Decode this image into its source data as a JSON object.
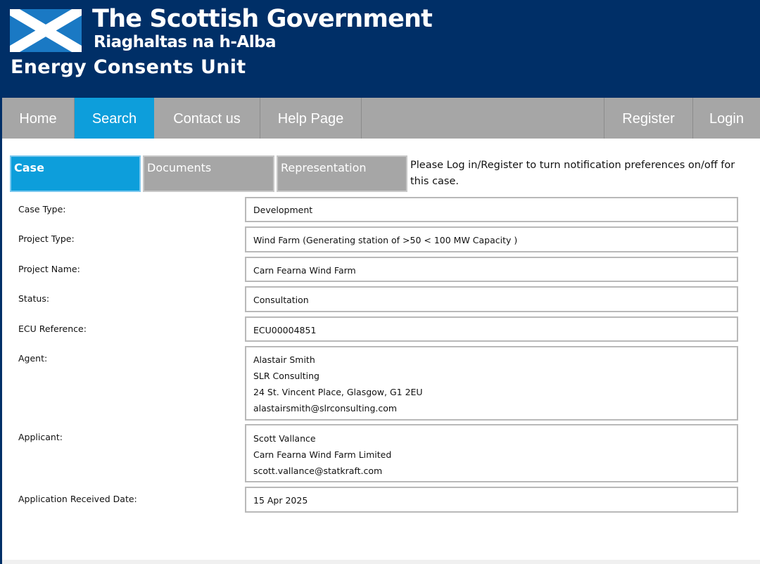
{
  "header": {
    "gov_title": "The Scottish Government",
    "gov_subtitle": "Riaghaltas na h-Alba",
    "unit_title": "Energy Consents Unit"
  },
  "nav": {
    "home": "Home",
    "search": "Search",
    "contact": "Contact us",
    "help": "Help Page",
    "register": "Register",
    "login": "Login"
  },
  "tabs": {
    "case": "Case",
    "documents": "Documents",
    "representation": "Representation"
  },
  "notice": "Please Log in/Register to turn notification preferences on/off for this case.",
  "fields": {
    "case_type": {
      "label": "Case Type:",
      "value": "Development"
    },
    "project_type": {
      "label": "Project Type:",
      "value": "Wind Farm (Generating station of >50 < 100 MW Capacity )"
    },
    "project_name": {
      "label": "Project Name:",
      "value": "Carn Fearna Wind Farm"
    },
    "status": {
      "label": "Status:",
      "value": "Consultation"
    },
    "ecu_reference": {
      "label": "ECU Reference:",
      "value": "ECU00004851"
    },
    "agent": {
      "label": "Agent:",
      "name": "Alastair Smith",
      "company": "SLR Consulting",
      "address": "24 St. Vincent Place, Glasgow, G1 2EU",
      "email": "alastairsmith@slrconsulting.com"
    },
    "applicant": {
      "label": "Applicant:",
      "name": "Scott Vallance",
      "company": "Carn Fearna Wind Farm Limited",
      "email": "scott.vallance@statkraft.com"
    },
    "received_date": {
      "label": "Application Received Date:",
      "value": "15 Apr 2025"
    }
  },
  "colors": {
    "header_bg": "#002f67",
    "nav_bg": "#a6a6a6",
    "accent": "#0d9edb",
    "field_border": "#b9b9b9"
  }
}
